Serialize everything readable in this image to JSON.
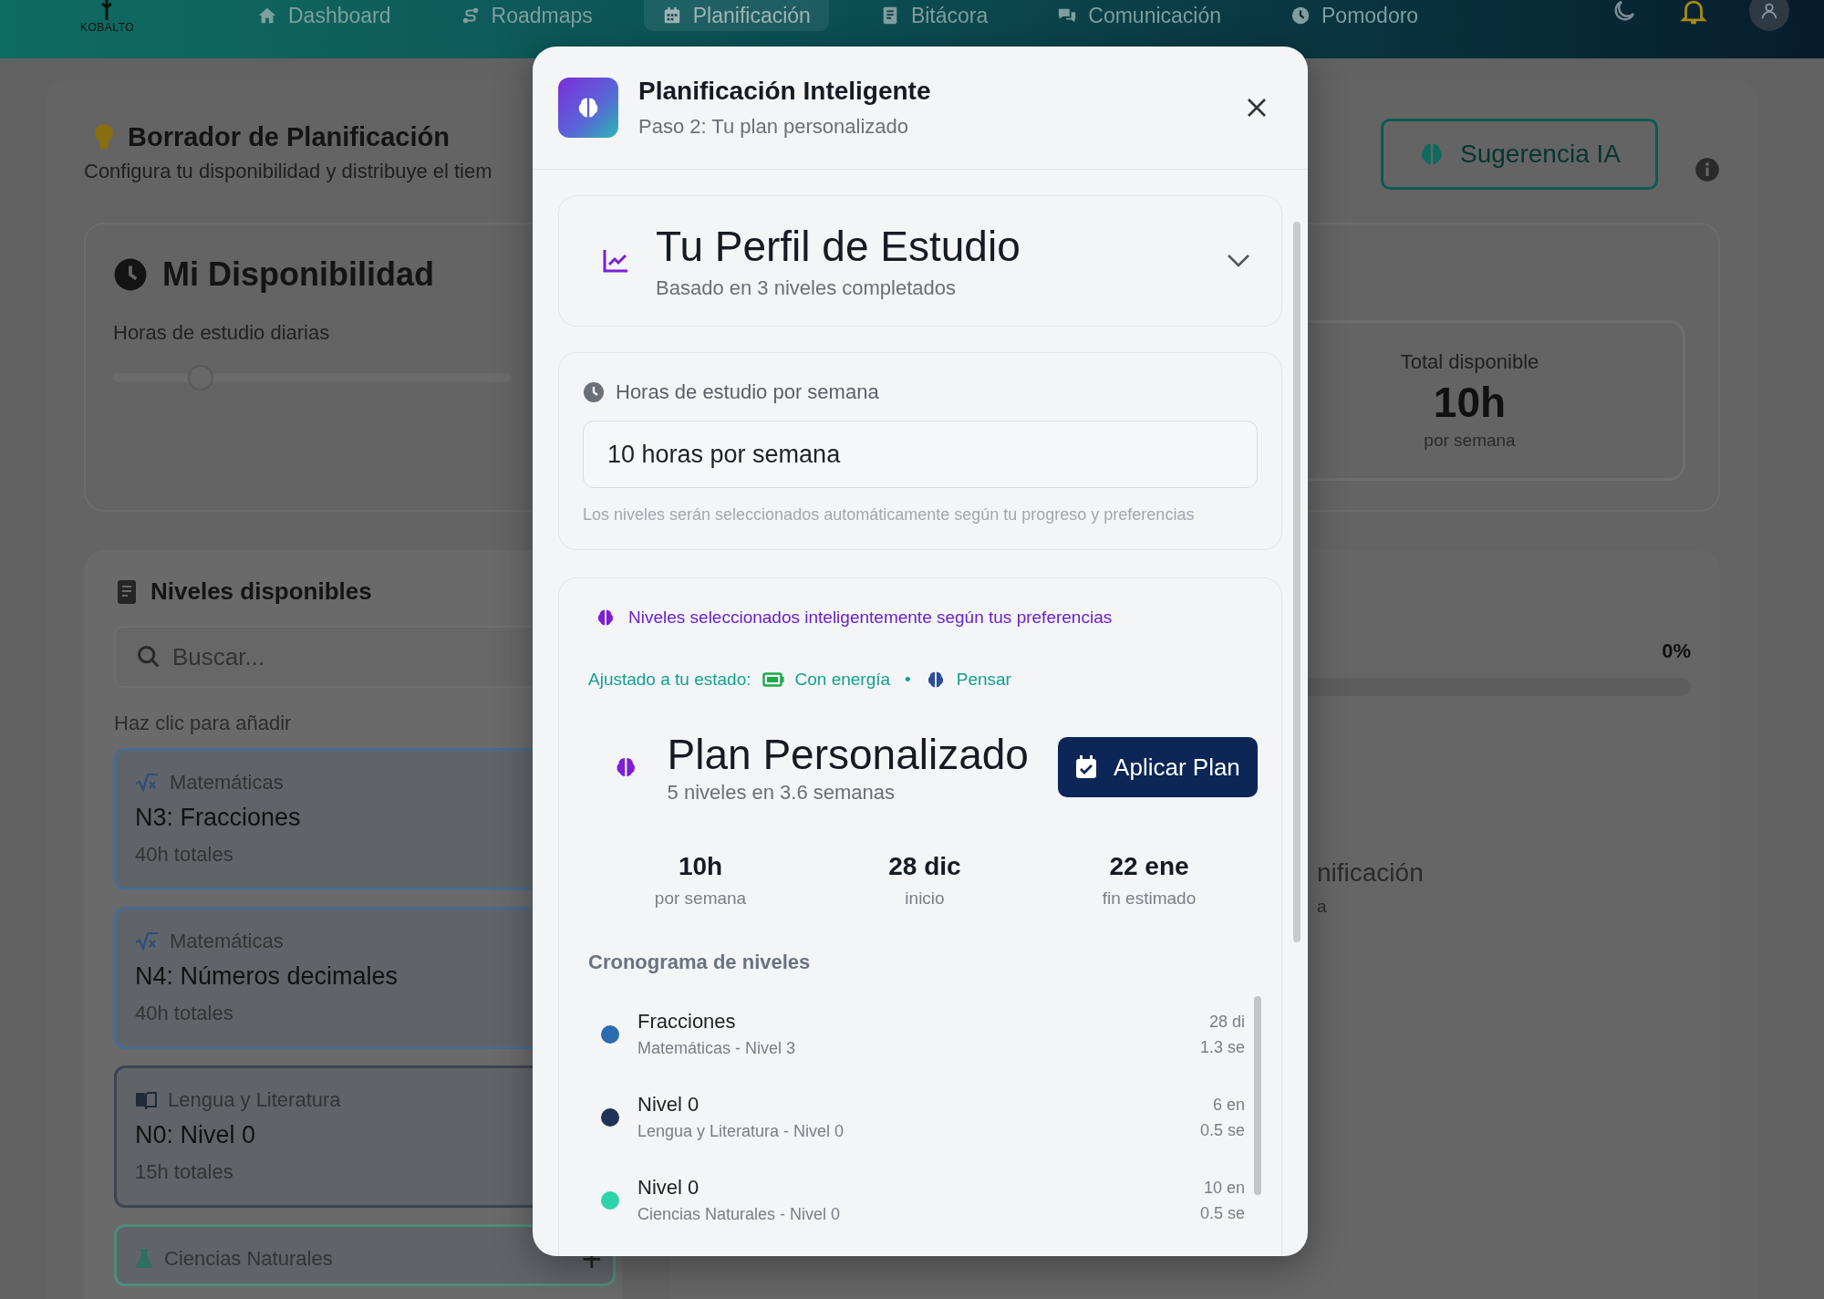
{
  "nav": {
    "logo": "KOBALTO",
    "items": [
      {
        "label": "Dashboard",
        "selected": false
      },
      {
        "label": "Roadmaps",
        "selected": false
      },
      {
        "label": "Planificación",
        "selected": true
      },
      {
        "label": "Bitácora",
        "selected": false
      },
      {
        "label": "Comunicación",
        "selected": false
      },
      {
        "label": "Pomodoro",
        "selected": false
      }
    ]
  },
  "page": {
    "title": "Borrador de Planificación",
    "subtitle": "Configura tu disponibilidad y distribuye el tiem",
    "suggest_button": "Sugerencia IA",
    "availability": {
      "title": "Mi Disponibilidad",
      "slider_label": "Horas de estudio diarias",
      "level": 0.22,
      "total_label": "Total disponible",
      "total_value": "10h",
      "total_unit": "por semana"
    },
    "levels_panel": {
      "title": "Niveles disponibles",
      "search_placeholder": "Buscar...",
      "hint": "Haz clic para añadir",
      "items": [
        {
          "kind": "math",
          "subject": "Matemáticas",
          "title": "N3: Fracciones",
          "hours": "40h totales",
          "color": "#4a6a90"
        },
        {
          "kind": "math",
          "subject": "Matemáticas",
          "title": "N4: Números decimales",
          "hours": "40h totales",
          "color": "#4a6a90"
        },
        {
          "kind": "language",
          "subject": "Lengua y Literatura",
          "title": "N0: Nivel 0",
          "hours": "15h totales",
          "color": "#3d4452"
        },
        {
          "kind": "science",
          "subject": "Ciencias Naturales",
          "action": "+",
          "color": "#4f8c7a"
        }
      ]
    },
    "progress": {
      "percent": "0%",
      "level": 0
    },
    "partial_title": "nificación",
    "partial_subtitle": "a"
  },
  "modal": {
    "title": "Planificación Inteligente",
    "subtitle": "Paso 2: Tu plan personalizado",
    "profile": {
      "title": "Tu Perfil de Estudio",
      "subtitle": "Basado en 3 niveles completados",
      "expanded": false
    },
    "hours": {
      "label": "Horas de estudio por semana",
      "value": "10 horas por semana",
      "hint": "Los niveles serán seleccionados automáticamente según tu progreso y preferencias"
    },
    "notice": "Niveles seleccionados inteligentemente según tus preferencias",
    "state": {
      "label": "Ajustado a tu estado:",
      "energy": "Con energía",
      "separator": "•",
      "mode": "Pensar"
    },
    "plan": {
      "title": "Plan Personalizado",
      "subtitle": "5 niveles en 3.6 semanas",
      "apply_button": "Aplicar Plan"
    },
    "stats": [
      {
        "value": "10h",
        "label": "por semana"
      },
      {
        "value": "28 dic",
        "label": "inicio"
      },
      {
        "value": "22 ene",
        "label": "fin estimado"
      }
    ],
    "schedule": {
      "title": "Cronograma de niveles",
      "items": [
        {
          "title": "Fracciones",
          "subtitle": "Matemáticas - Nivel 3",
          "date": "28 di",
          "duration": "1.3 se",
          "color": "#2b6cb0"
        },
        {
          "title": "Nivel 0",
          "subtitle": "Lengua y Literatura - Nivel 0",
          "date": "6 en",
          "duration": "0.5 se",
          "color": "#1f3358"
        },
        {
          "title": "Nivel 0",
          "subtitle": "Ciencias Naturales - Nivel 0",
          "date": "10 en",
          "duration": "0.5 se",
          "color": "#2dd4aa"
        }
      ]
    }
  }
}
